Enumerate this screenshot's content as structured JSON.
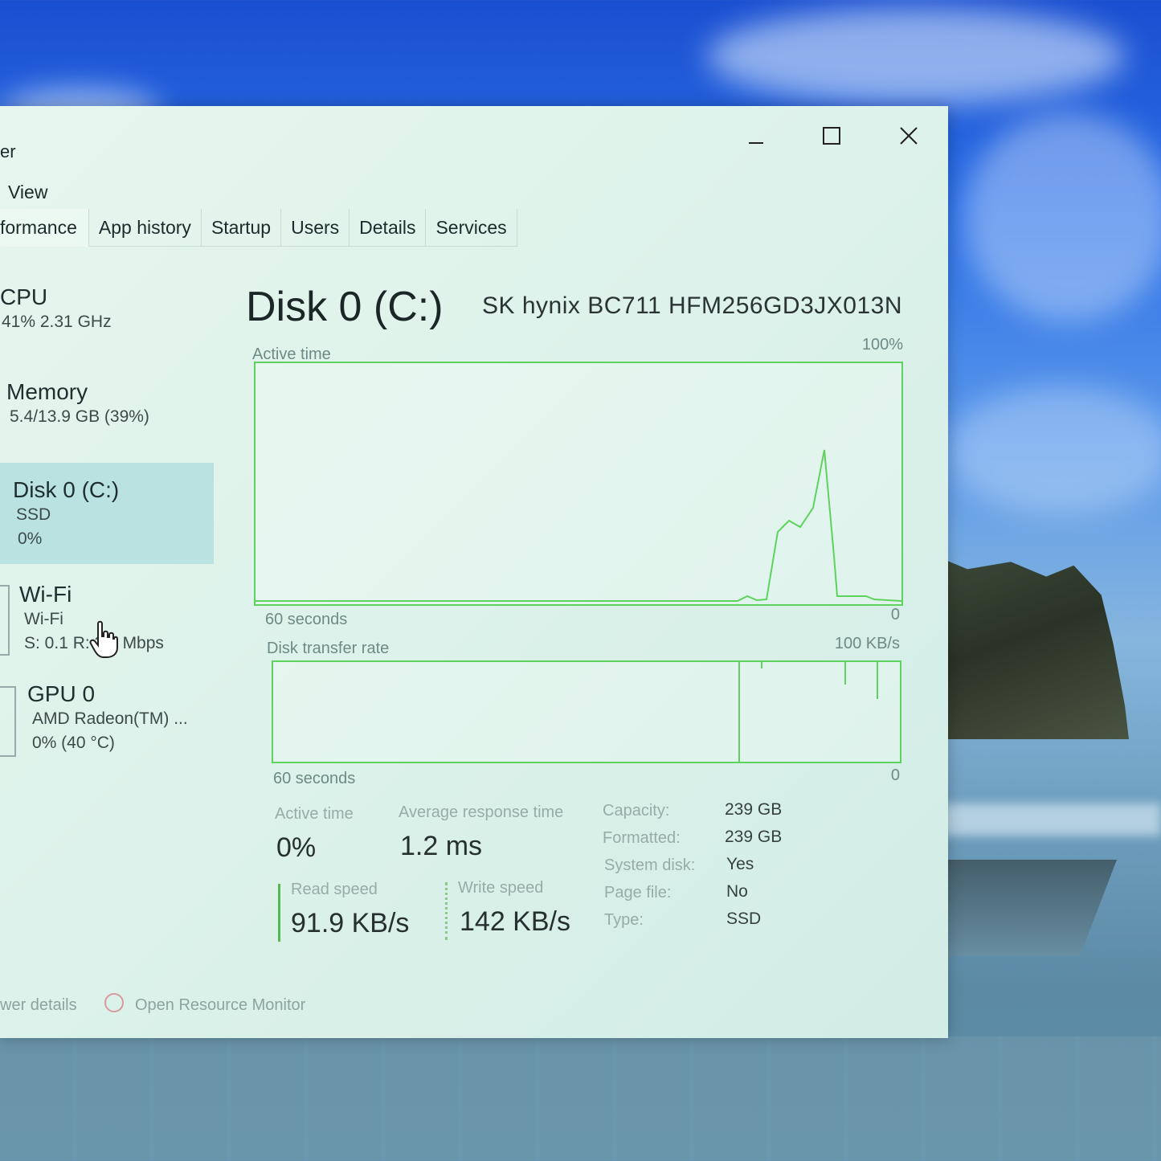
{
  "window": {
    "title": "er",
    "menu_view": "View",
    "controls": {
      "minimize": "minimize-icon",
      "maximize": "maximize-icon",
      "close": "close-icon"
    }
  },
  "tabs": [
    {
      "label": "formance",
      "active": true
    },
    {
      "label": "App history",
      "active": false
    },
    {
      "label": "Startup",
      "active": false
    },
    {
      "label": "Users",
      "active": false
    },
    {
      "label": "Details",
      "active": false
    },
    {
      "label": "Services",
      "active": false
    }
  ],
  "sidebar": {
    "cpu": {
      "name": "CPU",
      "line1": "41% 2.31 GHz"
    },
    "memory": {
      "name": "Memory",
      "line1": "5.4/13.9 GB (39%)"
    },
    "disk": {
      "name": "Disk 0 (C:)",
      "line1": "SSD",
      "line2": "0%"
    },
    "wifi": {
      "name": "Wi-Fi",
      "line1": "Wi-Fi",
      "line2": "S: 0.1 R: 3.7 Mbps"
    },
    "gpu": {
      "name": "GPU 0",
      "line1": "AMD Radeon(TM) ...",
      "line2": "0% (40 °C)"
    }
  },
  "main": {
    "title": "Disk 0 (C:)",
    "model": "SK hynix BC711 HFM256GD3JX013N",
    "active_graph": {
      "label": "Active time",
      "max": "100%",
      "left": "60 seconds",
      "right": "0"
    },
    "transfer_graph": {
      "label": "Disk transfer rate",
      "max": "100 KB/s",
      "left": "60 seconds",
      "right": "0"
    },
    "stats": {
      "active_time_label": "Active time",
      "active_time_value": "0%",
      "response_label": "Average response time",
      "response_value": "1.2 ms",
      "read_label": "Read speed",
      "read_value": "91.9 KB/s",
      "write_label": "Write speed",
      "write_value": "142 KB/s"
    },
    "properties": {
      "capacity_label": "Capacity:",
      "capacity_value": "239 GB",
      "formatted_label": "Formatted:",
      "formatted_value": "239 GB",
      "system_label": "System disk:",
      "system_value": "Yes",
      "pagefile_label": "Page file:",
      "pagefile_value": "No",
      "type_label": "Type:",
      "type_value": "SSD"
    }
  },
  "footer": {
    "fewer_details": "wer details",
    "resource_monitor": "Open Resource Monitor"
  },
  "colors": {
    "graph_line": "#5dd35d",
    "selected": "#b9e2e0"
  }
}
